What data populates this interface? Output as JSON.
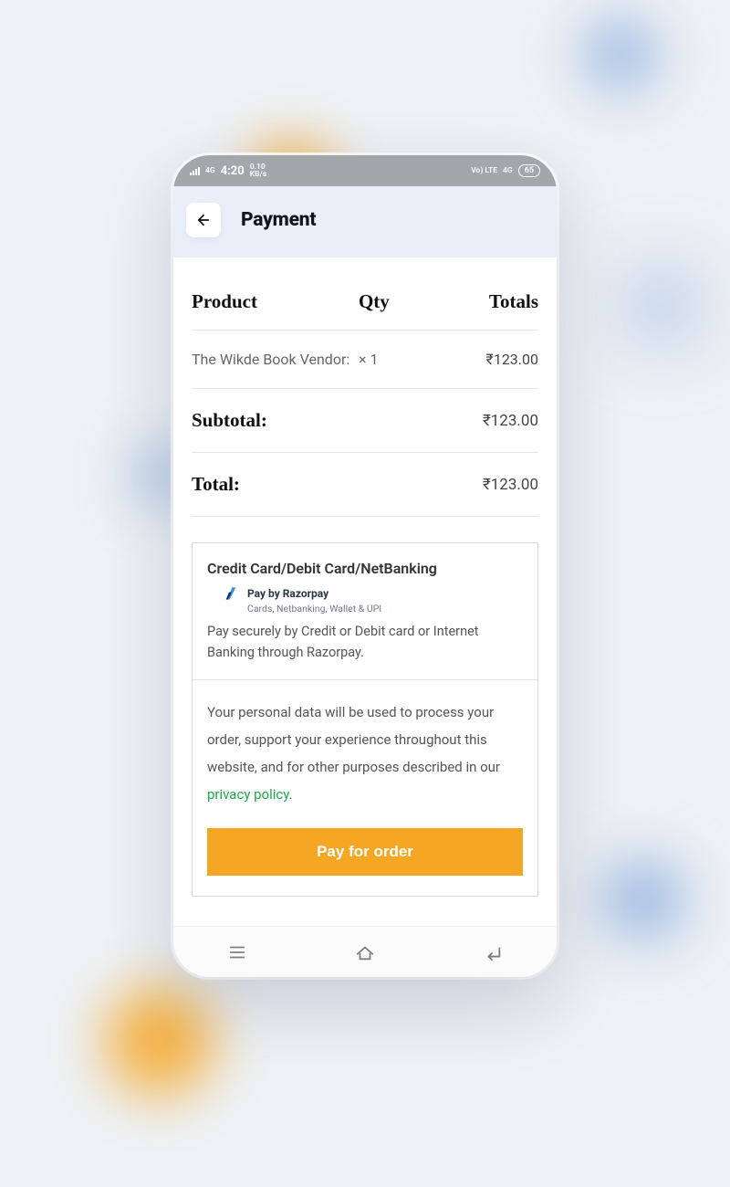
{
  "status": {
    "network_badge": "4G",
    "time": "4:20",
    "data_rate": "0.10",
    "data_unit": "KB/s",
    "lte_label": "Vo) LTE",
    "net_label": "4G",
    "battery": "65"
  },
  "header": {
    "title": "Payment"
  },
  "table": {
    "col_product": "Product",
    "col_qty": "Qty",
    "col_totals": "Totals",
    "item_name": "The Wikde Book Vendor:",
    "item_qty": "× 1",
    "item_total": "₹123.00",
    "subtotal_label": "Subtotal:",
    "subtotal_value": "₹123.00",
    "total_label": "Total:",
    "total_value": "₹123.00"
  },
  "payment": {
    "method_title": "Credit Card/Debit Card/NetBanking",
    "gateway_label": "Pay by Razorpay",
    "gateway_detail": "Cards, Netbanking, Wallet & UPI",
    "description": "Pay securely by Credit or Debit card or Internet Banking through Razorpay.",
    "privacy_text_pre": "Your personal data will be used to process your order, support your experience throughout this website, and for other purposes described in our ",
    "privacy_link": "privacy policy",
    "privacy_text_post": ".",
    "button_label": "Pay for order"
  }
}
